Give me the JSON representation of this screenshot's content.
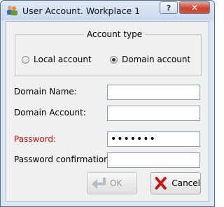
{
  "window": {
    "title": "User Account. Workplace 1",
    "help_label": "?",
    "close_label": "✕"
  },
  "account_type": {
    "title": "Account type",
    "options": [
      {
        "label": "Local account",
        "selected": false
      },
      {
        "label": "Domain account",
        "selected": true
      }
    ]
  },
  "form": {
    "domain_name_label": "Domain Name:",
    "domain_name_value": "",
    "domain_account_label": "Domain Account:",
    "domain_account_value": "",
    "password_label": "Password:",
    "password_value": "•••••••",
    "password_confirm_label": "Password confirmation:",
    "password_confirm_value": ""
  },
  "buttons": {
    "ok_label": "OK",
    "cancel_label": "Cancel"
  },
  "colors": {
    "required_label": "#d01010",
    "close_button": "#c8442e"
  }
}
